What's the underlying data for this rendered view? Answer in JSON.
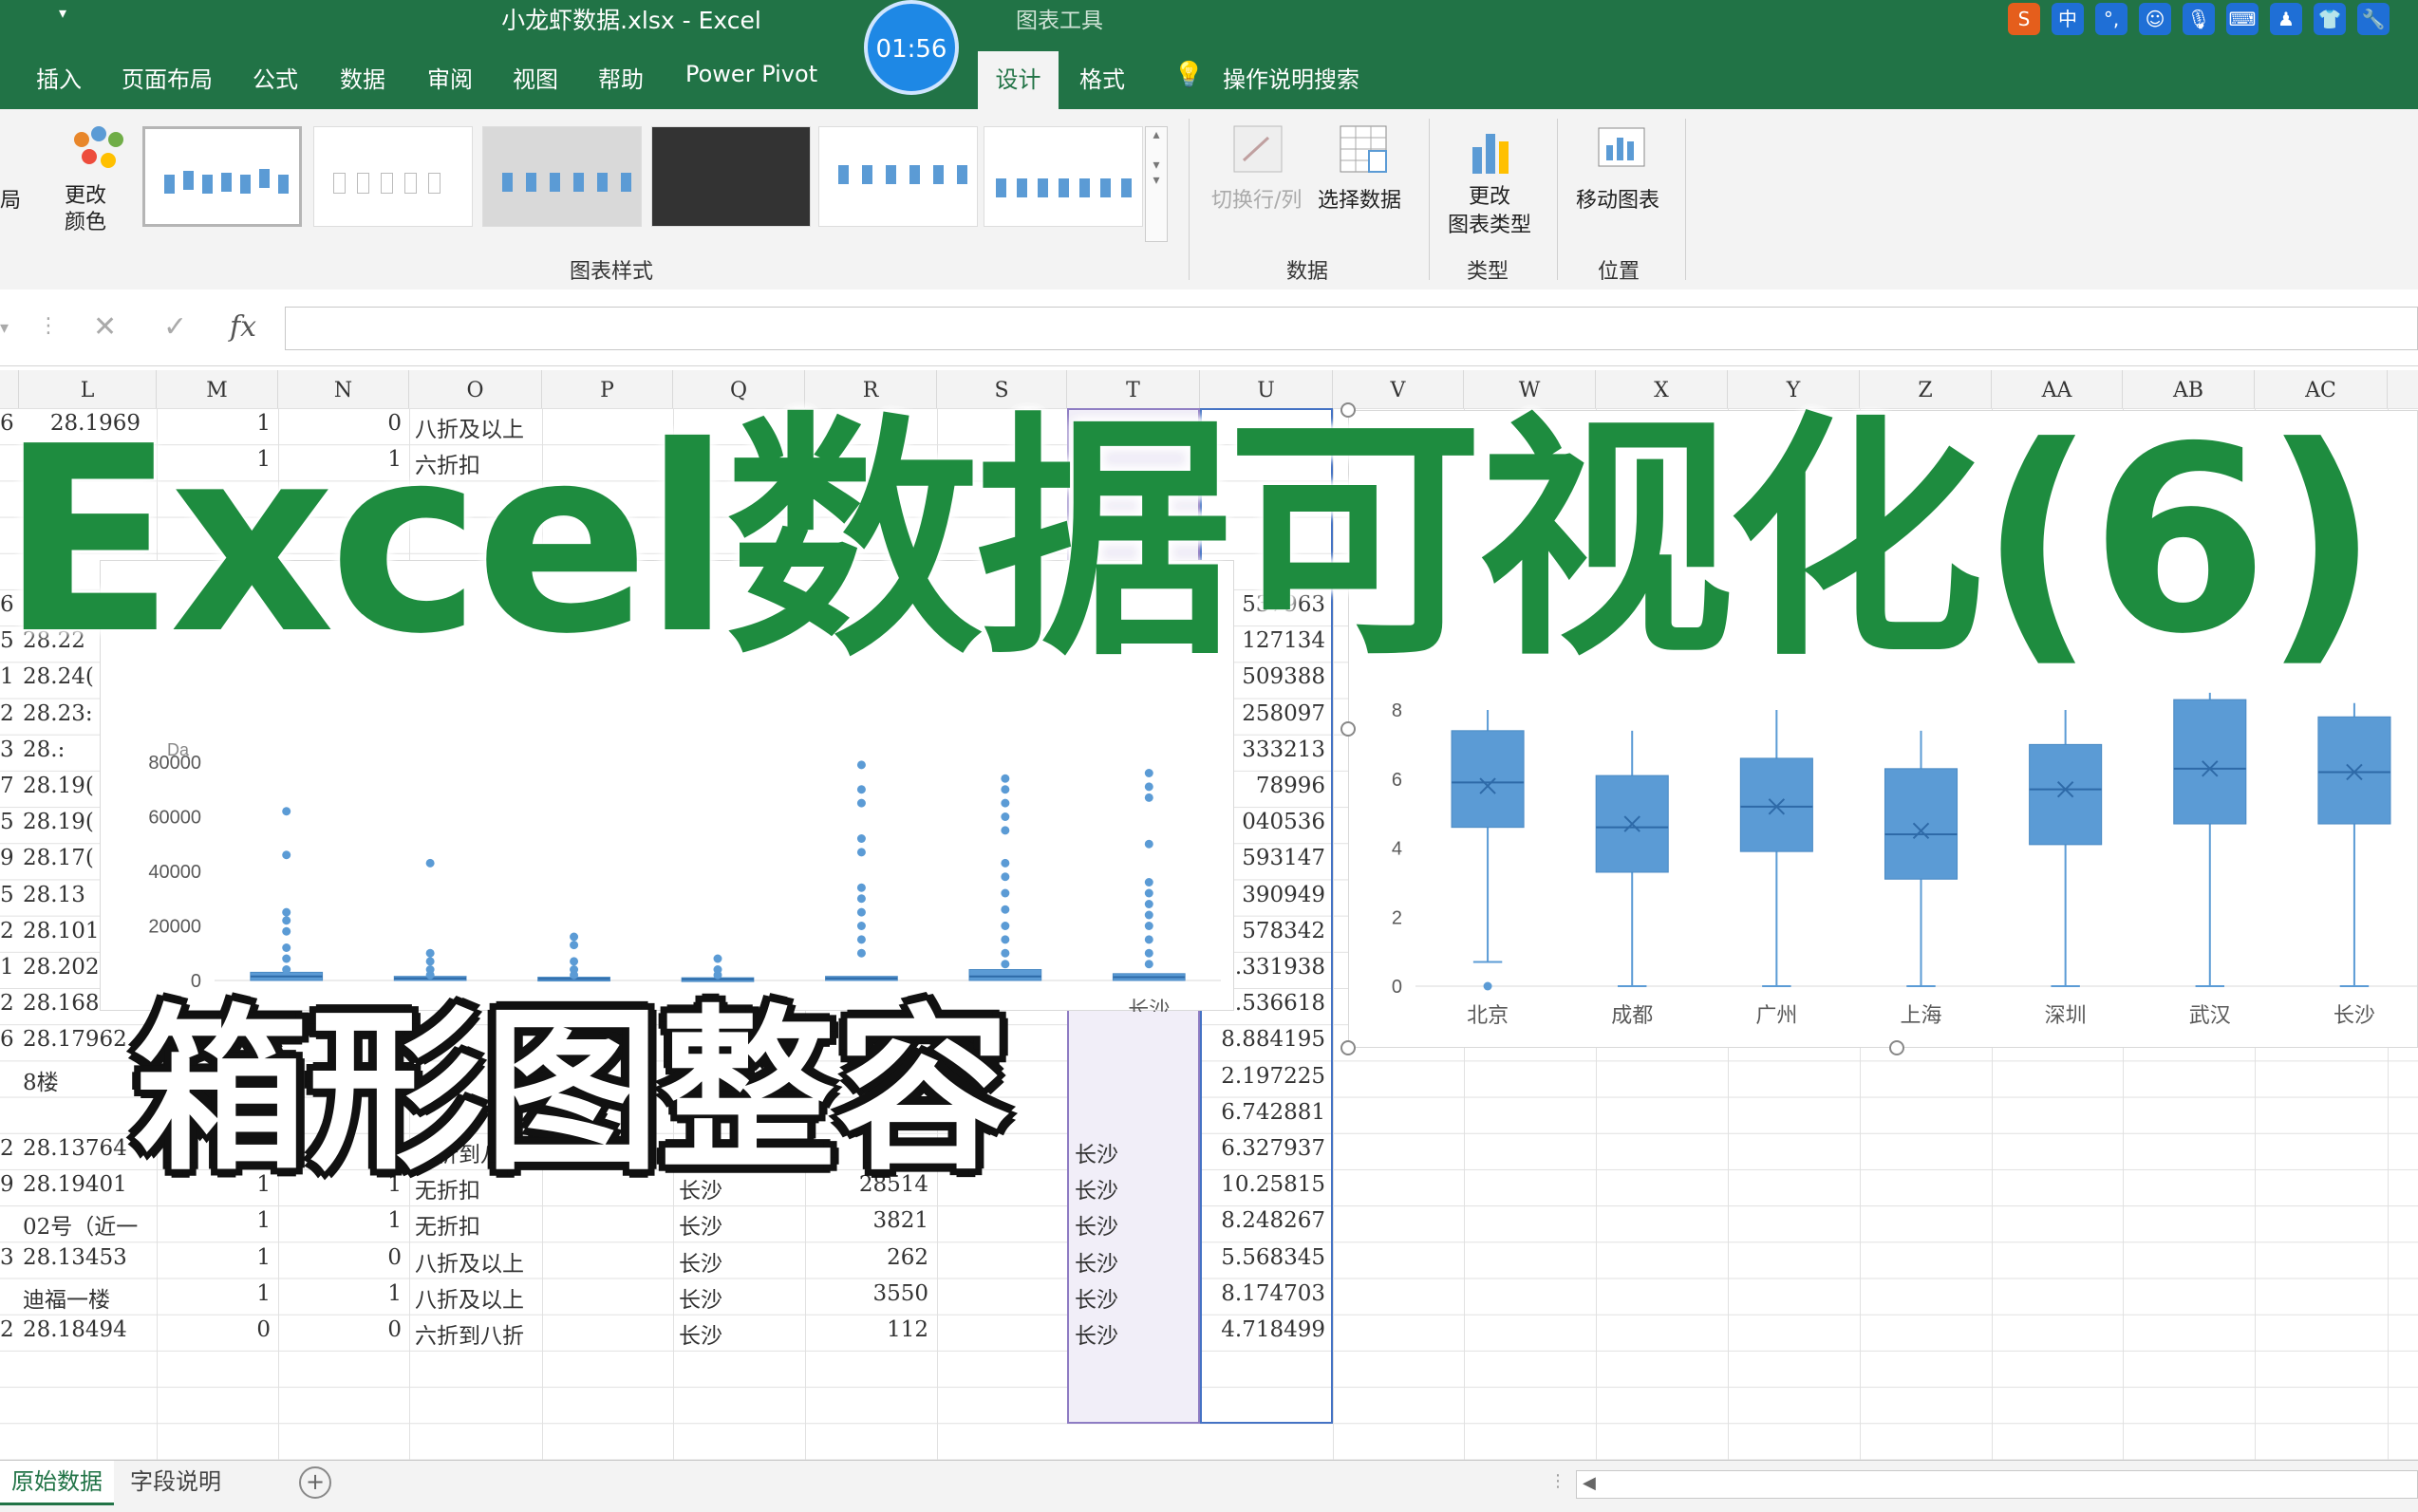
{
  "window": {
    "title": "小龙虾数据.xlsx  -  Excel",
    "context_tools_label": "图表工具",
    "timer": "01:56"
  },
  "tabs": [
    {
      "label": "插入"
    },
    {
      "label": "页面布局"
    },
    {
      "label": "公式"
    },
    {
      "label": "数据"
    },
    {
      "label": "审阅"
    },
    {
      "label": "视图"
    },
    {
      "label": "帮助"
    },
    {
      "label": "Power Pivot"
    },
    {
      "label": "设计"
    },
    {
      "label": "格式"
    },
    {
      "label": "操作说明搜索"
    }
  ],
  "ime_icons": [
    "sogou-icon",
    "中",
    "°,",
    "emoji-icon",
    "mic-icon",
    "keyboard-icon",
    "user-icon",
    "shirt-icon",
    "wrench-icon"
  ],
  "ribbon": {
    "layout_cut": "局",
    "change_colors": "更改\n颜色",
    "chart_styles_group": "图表样式",
    "switch_row_col": "切换行/列",
    "select_data": "选择数据",
    "data_group": "数据",
    "change_type": "更改\n图表类型",
    "type_group": "类型",
    "move_chart": "移动图表",
    "location_group": "位置"
  },
  "formula_bar": {
    "fx": "fx",
    "cancel": "✕",
    "confirm": "✓"
  },
  "columns": [
    "L",
    "M",
    "N",
    "O",
    "P",
    "Q",
    "R",
    "S",
    "T",
    "U",
    "V",
    "W",
    "X",
    "Y",
    "Z",
    "AA",
    "AB",
    "AC"
  ],
  "rows_top": [
    {
      "k": "6",
      "l": "28.1969",
      "m": "1",
      "n": "0",
      "o": "八折及以上"
    },
    {
      "k": "",
      "l": "",
      "m": "1",
      "n": "1",
      "o": "六折扣"
    }
  ],
  "rows_left": [
    {
      "k": "6",
      "l": "28.22("
    },
    {
      "k": "5",
      "l": "28.22"
    },
    {
      "k": "1",
      "l": "28.24("
    },
    {
      "k": "2",
      "l": "28.23:"
    },
    {
      "k": "3",
      "l": "28.:"
    },
    {
      "k": "7",
      "l": "28.19("
    },
    {
      "k": "5",
      "l": "28.19("
    },
    {
      "k": "9",
      "l": "28.17("
    },
    {
      "k": "5",
      "l": "28.13"
    },
    {
      "k": "2",
      "l": "28.10138"
    },
    {
      "k": "1",
      "l": "28.20244"
    },
    {
      "k": "2",
      "l": "28.16897"
    },
    {
      "k": "6",
      "l": "28.17962"
    },
    {
      "k": "",
      "l": "8楼"
    }
  ],
  "rows_bottom": [
    {
      "k": "2",
      "l": "28.13764",
      "m": "1",
      "n": "0",
      "o": "八折到八折",
      "q": "长沙",
      "r": "560",
      "t": "长沙",
      "u": "6.327937"
    },
    {
      "k": "9",
      "l": "28.19401",
      "m": "1",
      "n": "1",
      "o": "无折扣",
      "q": "长沙",
      "r": "28514",
      "t": "长沙",
      "u": "10.25815"
    },
    {
      "k": "",
      "l": "02号（近一",
      "m": "1",
      "n": "1",
      "o": "无折扣",
      "q": "长沙",
      "r": "3821",
      "t": "长沙",
      "u": "8.248267"
    },
    {
      "k": "3",
      "l": "28.13453",
      "m": "1",
      "n": "0",
      "o": "八折及以上",
      "q": "长沙",
      "r": "262",
      "t": "长沙",
      "u": "5.568345"
    },
    {
      "k": "",
      "l": "迪福一楼",
      "m": "1",
      "n": "1",
      "o": "八折及以上",
      "q": "长沙",
      "r": "3550",
      "t": "长沙",
      "u": "8.174703"
    },
    {
      "k": "2",
      "l": "28.18494",
      "m": "0",
      "n": "0",
      "o": "六折到八折",
      "q": "长沙",
      "r": "112",
      "t": "长沙",
      "u": "4.718499"
    }
  ],
  "col_u_values": [
    "537963",
    "127134",
    "509388",
    "258097",
    "333213",
    "78996",
    "040536",
    "593147",
    "390949",
    "578342",
    "9.331938",
    "9.536618",
    "8.884195",
    "2.197225",
    "6.742881"
  ],
  "left_chart_xlabel_visible": "长沙",
  "left_chart_partial_label": "Da",
  "chart_data": [
    {
      "type": "box",
      "title": "",
      "ylim": [
        0,
        80000
      ],
      "y_ticks": [
        "0",
        "20000",
        "40000",
        "60000",
        "80000"
      ],
      "categories": [
        "",
        "",
        "",
        "",
        "",
        "",
        "长沙"
      ],
      "series": [
        {
          "values": [
            {
              "q1": 0,
              "median": 1500,
              "q3": 3000,
              "outliers": [
                62000,
                46000,
                25000,
                22000,
                18000,
                12000,
                8000,
                4000
              ]
            },
            {
              "q1": 0,
              "median": 800,
              "q3": 1500,
              "outliers": [
                43000,
                10000,
                7000,
                4000,
                2000
              ]
            },
            {
              "q1": 0,
              "median": 600,
              "q3": 1200,
              "outliers": [
                16000,
                13000,
                7000,
                4000,
                2000
              ]
            },
            {
              "q1": 0,
              "median": 500,
              "q3": 1000,
              "outliers": [
                8000,
                4000,
                2000
              ]
            },
            {
              "q1": 0,
              "median": 800,
              "q3": 1500,
              "outliers": [
                79000,
                70000,
                65000,
                52000,
                47000,
                34000,
                30000,
                25000,
                20000,
                15000,
                10000
              ]
            },
            {
              "q1": 0,
              "median": 1500,
              "q3": 4000,
              "outliers": [
                74000,
                70000,
                65000,
                60000,
                55000,
                43000,
                38000,
                32000,
                26000,
                20000,
                15000,
                10000,
                6000
              ]
            },
            {
              "q1": 0,
              "median": 1200,
              "q3": 2500,
              "outliers": [
                76000,
                71000,
                67000,
                50000,
                36000,
                32000,
                28000,
                24000,
                20000,
                15000,
                10000,
                6000
              ]
            }
          ]
        }
      ]
    },
    {
      "type": "box",
      "title": "",
      "ylim": [
        0,
        8
      ],
      "y_ticks": [
        "0",
        "2",
        "4",
        "6",
        "8"
      ],
      "categories": [
        "北京",
        "成都",
        "广州",
        "上海",
        "深圳",
        "武汉",
        "长沙"
      ],
      "series": [
        {
          "values": [
            {
              "min": 0.7,
              "q1": 4.6,
              "median": 5.9,
              "mean": 5.8,
              "q3": 7.4,
              "max": 8.0,
              "outliers": [
                0.0
              ]
            },
            {
              "min": 0.0,
              "q1": 3.3,
              "median": 4.6,
              "mean": 4.7,
              "q3": 6.1,
              "max": 7.4
            },
            {
              "min": 0.0,
              "q1": 3.9,
              "median": 5.2,
              "mean": 5.2,
              "q3": 6.6,
              "max": 8.0
            },
            {
              "min": 0.0,
              "q1": 3.1,
              "median": 4.4,
              "mean": 4.5,
              "q3": 6.3,
              "max": 7.4
            },
            {
              "min": 0.0,
              "q1": 4.1,
              "median": 5.7,
              "mean": 5.7,
              "q3": 7.0,
              "max": 8.0
            },
            {
              "min": 0.0,
              "q1": 4.7,
              "median": 6.3,
              "mean": 6.3,
              "q3": 8.3,
              "max": 8.5
            },
            {
              "min": 0.0,
              "q1": 4.7,
              "median": 6.2,
              "mean": 6.2,
              "q3": 7.8,
              "max": 8.2
            }
          ]
        }
      ]
    }
  ],
  "overlay": {
    "title": "Excel数据可视化(6)",
    "subtitle": "箱形图整容"
  },
  "sheets": [
    {
      "label": "原始数据"
    },
    {
      "label": "字段说明"
    }
  ],
  "colors": {
    "excel_green": "#217346",
    "box_fill": "#5b9bd5",
    "title_green": "#1e8c3f"
  }
}
